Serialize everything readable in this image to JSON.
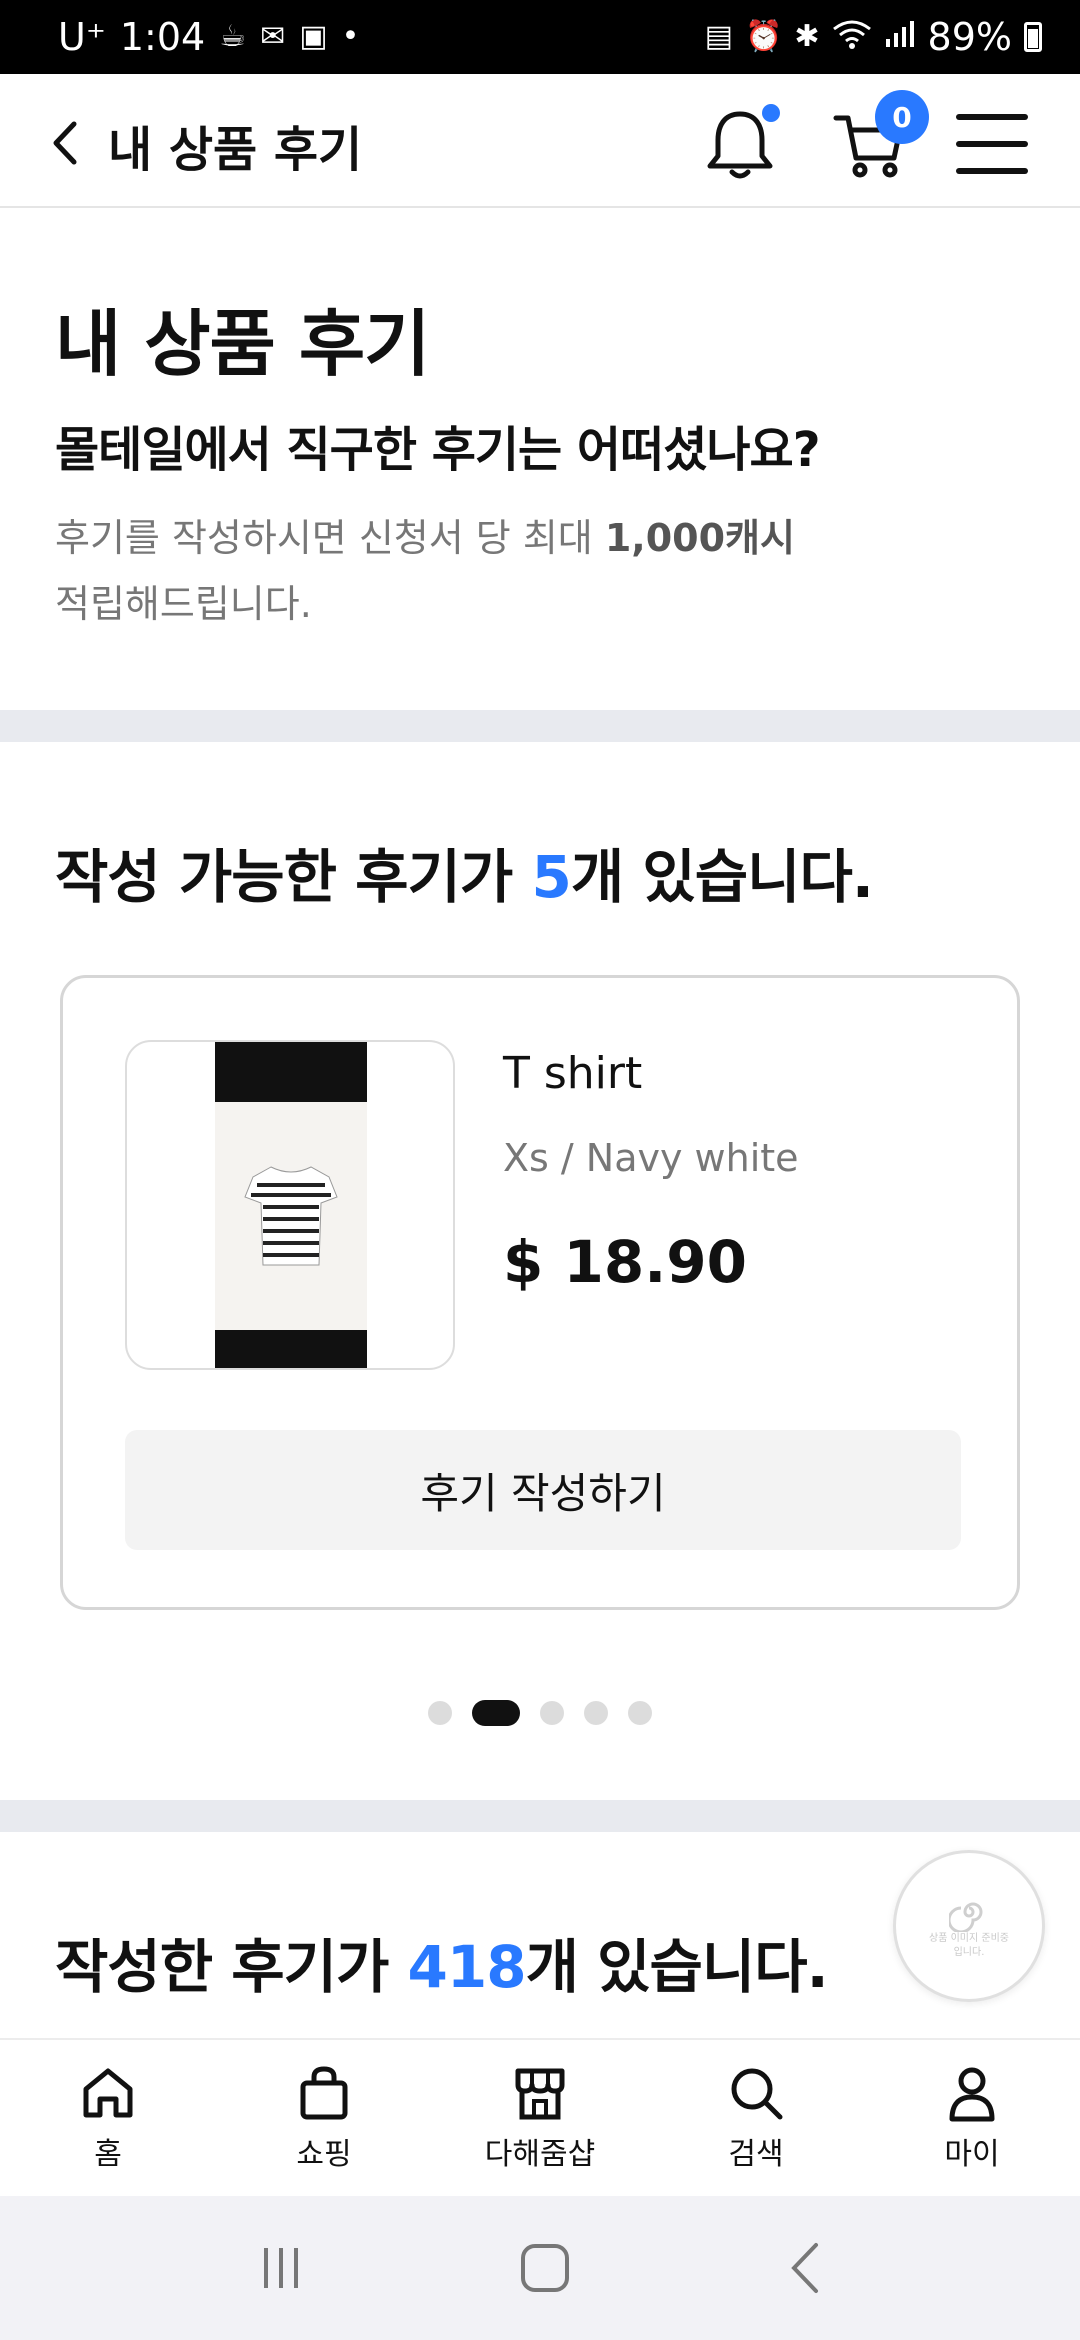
{
  "status_bar": {
    "carrier": "U⁺",
    "time": "1:04",
    "battery_percent": "89%"
  },
  "header": {
    "title": "내 상품 후기",
    "cart_count": "0"
  },
  "intro": {
    "title": "내 상품 후기",
    "subtitle": "몰테일에서 직구한 후기는 어떠셨나요?",
    "desc_before": "후기를 작성하시면 신청서 당 최대 ",
    "desc_highlight": "1,000캐시",
    "desc_after": "적립해드립니다."
  },
  "available": {
    "title_before": "작성 가능한 후기가 ",
    "count": "5",
    "title_after": "개 있습니다.",
    "card": {
      "product_name": "T shirt",
      "option": "Xs / Navy white",
      "price": "$ 18.90",
      "write_button": "후기 작성하기"
    },
    "pager": {
      "total": 5,
      "active_index": 1
    }
  },
  "written": {
    "title_before": "작성한 후기가 ",
    "count": "418",
    "title_after": "개 있습니다."
  },
  "float_button": {
    "text": "상품 이미지 준비중 입니다."
  },
  "bottom_nav": {
    "items": [
      {
        "label": "홈",
        "icon": "home-icon"
      },
      {
        "label": "쇼핑",
        "icon": "shopping-bag-icon"
      },
      {
        "label": "다해줌샵",
        "icon": "store-icon"
      },
      {
        "label": "검색",
        "icon": "search-icon"
      },
      {
        "label": "마이",
        "icon": "person-icon"
      }
    ]
  },
  "colors": {
    "accent": "#2979ff",
    "divider": "#e8eaef",
    "button_bg": "#f3f3f3"
  }
}
